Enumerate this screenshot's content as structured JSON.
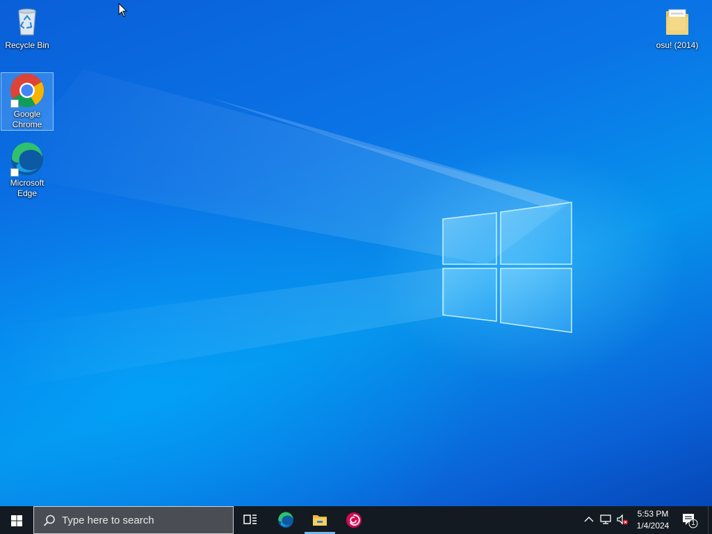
{
  "desktop": {
    "icons": [
      {
        "label": "Recycle Bin",
        "icon": "recycle-bin-icon"
      },
      {
        "label": "Google Chrome",
        "line1": "Google",
        "line2": "Chrome",
        "icon": "chrome-icon",
        "selected": true
      },
      {
        "label": "Microsoft Edge",
        "line1": "Microsoft",
        "line2": "Edge",
        "icon": "edge-icon"
      },
      {
        "label": "osu! (2014)",
        "icon": "folder-icon"
      }
    ]
  },
  "taskbar": {
    "search_placeholder": "Type here to search",
    "pinned": [
      {
        "name": "Task View",
        "icon": "task-view-icon"
      },
      {
        "name": "Microsoft Edge",
        "icon": "edge-icon"
      },
      {
        "name": "File Explorer",
        "icon": "file-explorer-icon",
        "active": true
      },
      {
        "name": "Debian",
        "icon": "debian-icon"
      }
    ],
    "tray": {
      "time": "5:53 PM",
      "date": "1/4/2024",
      "notification_count": "1"
    }
  },
  "colors": {
    "taskbar": "#141a22",
    "accent": "#76b9ed",
    "wallpaper": "#0a74e6"
  }
}
